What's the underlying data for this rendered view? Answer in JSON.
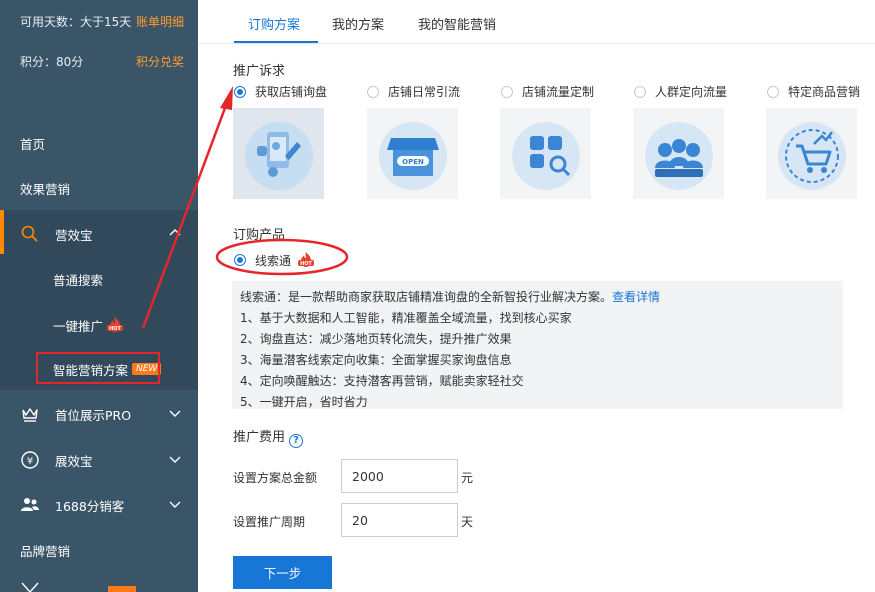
{
  "sidebar": {
    "available_days_label": "可用天数：大于15天",
    "billing_link": "账单明细",
    "points_label": "积分：80分",
    "points_link": "积分兑奖",
    "items": [
      {
        "label": "首页"
      },
      {
        "label": "效果营销"
      },
      {
        "label": "营效宝"
      },
      {
        "label": "普通搜索"
      },
      {
        "label": "一键推广"
      },
      {
        "label": "智能营销方案"
      },
      {
        "label": "首位展示PRO"
      },
      {
        "label": "展效宝"
      },
      {
        "label": "1688分销客"
      },
      {
        "label": "品牌营销"
      }
    ],
    "new_badge": "NEW",
    "hot_badge": "HOT"
  },
  "tabs": [
    {
      "label": "订购方案"
    },
    {
      "label": "我的方案"
    },
    {
      "label": "我的智能营销"
    }
  ],
  "promotion": {
    "title": "推广诉求",
    "options": [
      {
        "label": "获取店铺询盘",
        "selected": true,
        "icon": "shop-inquiry-icon"
      },
      {
        "label": "店铺日常引流",
        "selected": false,
        "icon": "open-shop-icon"
      },
      {
        "label": "店铺流量定制",
        "selected": false,
        "icon": "traffic-custom-icon"
      },
      {
        "label": "人群定向流量",
        "selected": false,
        "icon": "crowd-target-icon"
      },
      {
        "label": "特定商品营销",
        "selected": false,
        "icon": "product-cart-icon"
      }
    ]
  },
  "product": {
    "title": "订购产品",
    "name": "线索通",
    "hot_badge": "HOT",
    "description_intro": "线索通：是一款帮助商家获取店铺精准询盘的全新智投行业解决方案。",
    "details_link": "查看详情",
    "features": [
      "1、基于大数据和人工智能，精准覆盖全域流量，找到核心买家",
      "2、询盘直达：减少落地页转化流失，提升推广效果",
      "3、海量潜客线索定向收集：全面掌握买家询盘信息",
      "4、定向唤醒触达：支持潜客再营销，赋能卖家轻社交",
      "5、一键开启，省时省力"
    ]
  },
  "fee": {
    "title": "推广费用",
    "total_label": "设置方案总金额",
    "total_value": "2000",
    "total_unit": "元",
    "period_label": "设置推广周期",
    "period_value": "20",
    "period_unit": "天",
    "next_button": "下一步"
  },
  "colors": {
    "accent": "#1677d6",
    "sidebar_bg": "#3a5468",
    "highlight": "#ff8a00",
    "annotation_red": "#e5262a"
  }
}
